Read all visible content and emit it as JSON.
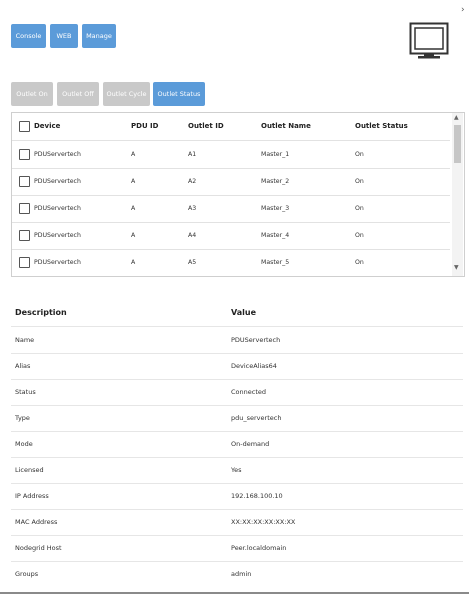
{
  "top_tabs": [
    "Console",
    "WEB",
    "Manage"
  ],
  "outlet_actions": [
    {
      "label": "Outlet On",
      "active": false
    },
    {
      "label": "Outlet Off",
      "active": false
    },
    {
      "label": "Outlet Cycle",
      "active": false
    },
    {
      "label": "Outlet Status",
      "active": true
    }
  ],
  "outlets": {
    "columns": [
      "Device",
      "PDU ID",
      "Outlet ID",
      "Outlet Name",
      "Outlet Status"
    ],
    "rows": [
      [
        "PDUServertech",
        "A",
        "A1",
        "Master_1",
        "On"
      ],
      [
        "PDUServertech",
        "A",
        "A2",
        "Master_2",
        "On"
      ],
      [
        "PDUServertech",
        "A",
        "A3",
        "Master_3",
        "On"
      ],
      [
        "PDUServertech",
        "A",
        "A4",
        "Master_4",
        "On"
      ],
      [
        "PDUServertech",
        "A",
        "A5",
        "Master_5",
        "On"
      ]
    ]
  },
  "details": {
    "columns": [
      "Description",
      "Value"
    ],
    "rows": [
      [
        "Name",
        "PDUServertech"
      ],
      [
        "Alias",
        "DeviceAlias64"
      ],
      [
        "Status",
        "Connected"
      ],
      [
        "Type",
        "pdu_servertech"
      ],
      [
        "Mode",
        "On-demand"
      ],
      [
        "Licensed",
        "Yes"
      ],
      [
        "IP Address",
        "192.168.100.10"
      ],
      [
        "MAC Address",
        "XX:XX:XX:XX:XX:XX"
      ],
      [
        "Nodegrid Host",
        "Peer.localdomain"
      ],
      [
        "Groups",
        "admin"
      ]
    ]
  },
  "icons": {
    "collapse": "chevron-right-icon",
    "monitor": "monitor-icon",
    "scroll_up": "triangle-up-icon",
    "scroll_down": "triangle-down-icon"
  },
  "colors": {
    "button_blue": "#5b9bd9",
    "button_disabled": "#c9c9c9"
  }
}
